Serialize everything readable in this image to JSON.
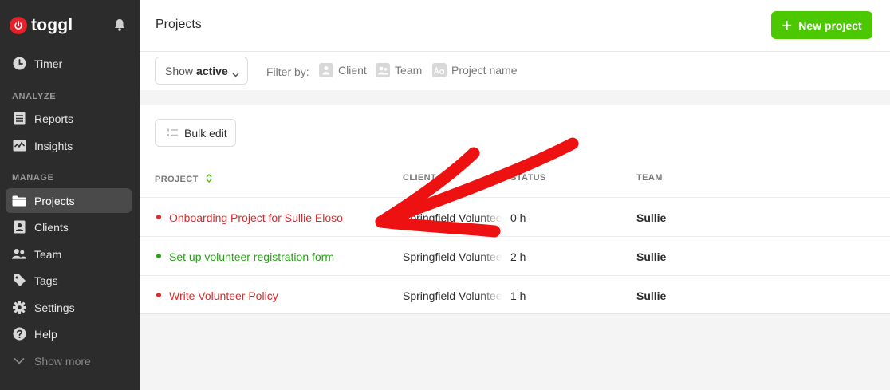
{
  "brand": {
    "name": "toggl",
    "accent": "#e5212b",
    "green": "#4bc800"
  },
  "sidebar": {
    "top_items": [
      {
        "label": "Timer",
        "icon": "clock-icon"
      }
    ],
    "sections": [
      {
        "title": "ANALYZE",
        "items": [
          {
            "label": "Reports",
            "icon": "reports-icon"
          },
          {
            "label": "Insights",
            "icon": "insights-icon"
          }
        ]
      },
      {
        "title": "MANAGE",
        "items": [
          {
            "label": "Projects",
            "icon": "folder-icon",
            "active": true
          },
          {
            "label": "Clients",
            "icon": "client-icon"
          },
          {
            "label": "Team",
            "icon": "team-icon"
          },
          {
            "label": "Tags",
            "icon": "tag-icon"
          },
          {
            "label": "Settings",
            "icon": "gear-icon"
          },
          {
            "label": "Help",
            "icon": "help-icon"
          },
          {
            "label": "Show more",
            "icon": "chevron-down-icon"
          }
        ]
      }
    ]
  },
  "header": {
    "title": "Projects",
    "new_project_label": "New project"
  },
  "filters": {
    "show_prefix": "Show",
    "show_value": "active",
    "filter_by_label": "Filter by:",
    "options": [
      {
        "label": "Client",
        "icon": "client-filter-icon"
      },
      {
        "label": "Team",
        "icon": "team-filter-icon"
      },
      {
        "label": "Project name",
        "icon": "text-filter-icon"
      }
    ]
  },
  "toolbar": {
    "bulk_edit_label": "Bulk edit"
  },
  "table": {
    "columns": [
      "PROJECT",
      "CLIENT",
      "STATUS",
      "TEAM"
    ],
    "rows": [
      {
        "project": "Onboarding Project for Sullie Eloso",
        "color": "#d92b2b",
        "client": "Springfield Volunteer",
        "status": "0 h",
        "team": "Sullie"
      },
      {
        "project": "Set up volunteer registration form",
        "color": "#2da01c",
        "client": "Springfield Volunteer",
        "status": "2 h",
        "team": "Sullie"
      },
      {
        "project": "Write Volunteer Policy",
        "color": "#d92b2b",
        "client": "Springfield Volunteer",
        "status": "1 h",
        "team": "Sullie"
      }
    ]
  }
}
